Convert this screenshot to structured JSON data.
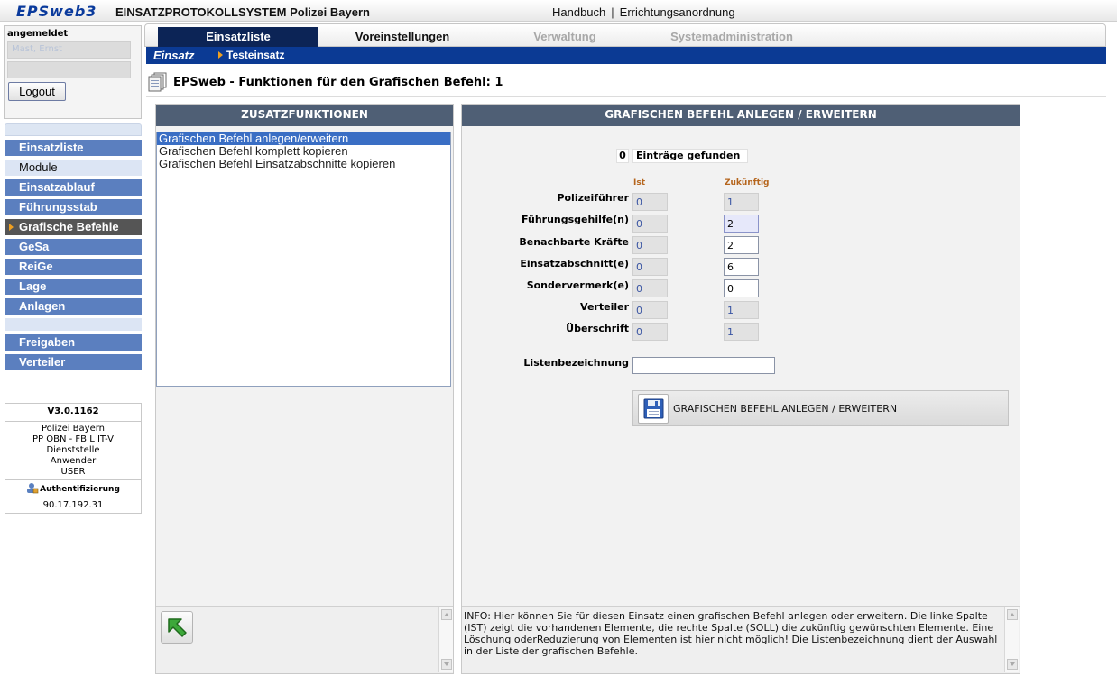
{
  "header": {
    "logo": "EPSweb3",
    "system_title": "EINSATZPROTOKOLLSYSTEM Polizei Bayern",
    "link_handbuch": "Handbuch",
    "link_separator": "|",
    "link_errichtung": "Errichtungsanordnung"
  },
  "login": {
    "label": "angemeldet",
    "user_value": "Mast, Ernst",
    "logout_label": "Logout"
  },
  "sidebar": {
    "items": [
      {
        "label": "Einsatzliste",
        "style": "normal"
      },
      {
        "label": "Module",
        "style": "light"
      },
      {
        "label": "Einsatzablauf",
        "style": "normal"
      },
      {
        "label": "Führungsstab",
        "style": "normal"
      },
      {
        "label": "Grafische Befehle",
        "style": "active"
      },
      {
        "label": "GeSa",
        "style": "normal"
      },
      {
        "label": "ReiGe",
        "style": "normal"
      },
      {
        "label": "Lage",
        "style": "normal"
      },
      {
        "label": "Anlagen",
        "style": "normal"
      },
      {
        "label": "Freigaben",
        "style": "normal"
      },
      {
        "label": "Verteiler",
        "style": "normal"
      }
    ]
  },
  "info": {
    "version": "V3.0.1162",
    "org_line1": "Polizei Bayern",
    "org_line2": "PP OBN - FB L IT-V",
    "org_line3": "Dienststelle",
    "org_line4": "Anwender",
    "org_line5": "USER",
    "auth_label": "Authentifizierung",
    "ip": "90.17.192.31"
  },
  "tabs": {
    "einsatzliste": "Einsatzliste",
    "voreinstellungen": "Voreinstellungen",
    "verwaltung": "Verwaltung",
    "systemadministration": "Systemadministration"
  },
  "breadcrumb": {
    "root": "Einsatz",
    "current": "Testeinsatz"
  },
  "page_title": "EPSweb - Funktionen für den Grafischen Befehl: 1",
  "left_panel": {
    "title": "ZUSATZFUNKTIONEN",
    "functions": [
      "Grafischen Befehl anlegen/erweitern",
      "Grafischen Befehl komplett kopieren",
      "Grafischen Befehl Einsatzabschnitte kopieren"
    ]
  },
  "right_panel": {
    "title": "GRAFISCHEN BEFEHL ANLEGEN / ERWEITERN",
    "found_count": "0",
    "found_label": "Einträge gefunden",
    "col_ist": "Ist",
    "col_zuk": "Zukünftig",
    "rows": [
      {
        "label": "Polizeiführer",
        "ist": "0",
        "zuk": "1"
      },
      {
        "label": "Führungsgehilfe(n)",
        "ist": "0",
        "zuk": "2"
      },
      {
        "label": "Benachbarte Kräfte",
        "ist": "0",
        "zuk": "2"
      },
      {
        "label": "Einsatzabschnitt(e)",
        "ist": "0",
        "zuk": "6"
      },
      {
        "label": "Sondervermerk(e)",
        "ist": "0",
        "zuk": "0"
      },
      {
        "label": "Verteiler",
        "ist": "0",
        "zuk": "1"
      },
      {
        "label": "Überschrift",
        "ist": "0",
        "zuk": "1"
      }
    ],
    "listbez_label": "Listenbezeichnung",
    "listbez_value": "",
    "create_button": "GRAFISCHEN BEFEHL ANLEGEN / ERWEITERN",
    "info_text": "INFO: Hier können Sie für diesen Einsatz einen grafischen Befehl anlegen oder erweitern. Die linke Spalte (IST) zeigt die vorhandenen Elemente, die rechte Spalte (SOLL) die zukünftig gewünschten Elemente. Eine Löschung oderReduzierung von Elementen ist hier nicht möglich! Die Listenbezeichnung dient der Auswahl in der Liste der grafischen Befehle."
  },
  "colors": {
    "nav_blue": "#5b7fbf",
    "tab_active": "#0c2456",
    "breadcrumb_bg": "#0b3a94",
    "panel_head": "#4f5f75",
    "column_head": "#b5651d",
    "selection": "#3a6ec4"
  },
  "icons": {
    "document": "document-stack-icon",
    "save": "floppy-disk-icon",
    "back": "arrow-up-left-icon",
    "auth": "user-lock-icon"
  }
}
